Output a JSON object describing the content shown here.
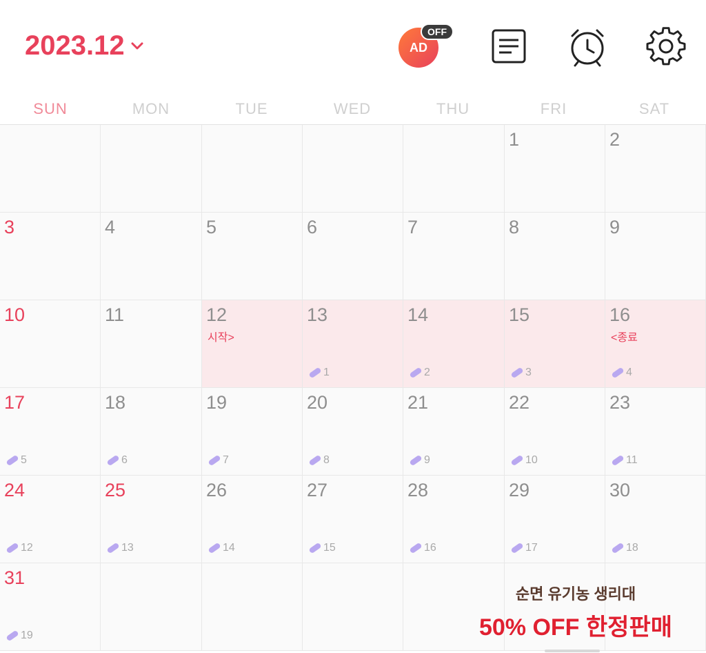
{
  "header": {
    "month": "2023.12",
    "ad_badge": "AD",
    "ad_off": "OFF"
  },
  "weekdays": [
    "SUN",
    "MON",
    "TUE",
    "WED",
    "THU",
    "FRI",
    "SAT"
  ],
  "weeks": [
    [
      {
        "d": ""
      },
      {
        "d": ""
      },
      {
        "d": ""
      },
      {
        "d": ""
      },
      {
        "d": ""
      },
      {
        "d": "1"
      },
      {
        "d": "2"
      }
    ],
    [
      {
        "d": "3",
        "red": true
      },
      {
        "d": "4"
      },
      {
        "d": "5"
      },
      {
        "d": "6"
      },
      {
        "d": "7"
      },
      {
        "d": "8"
      },
      {
        "d": "9"
      }
    ],
    [
      {
        "d": "10",
        "red": true
      },
      {
        "d": "11"
      },
      {
        "d": "12",
        "hl": true,
        "note": "시작>"
      },
      {
        "d": "13",
        "hl": true,
        "pill": "1"
      },
      {
        "d": "14",
        "hl": true,
        "pill": "2"
      },
      {
        "d": "15",
        "hl": true,
        "pill": "3"
      },
      {
        "d": "16",
        "hl": true,
        "note": "<종료",
        "pill": "4"
      }
    ],
    [
      {
        "d": "17",
        "red": true,
        "pill": "5"
      },
      {
        "d": "18",
        "pill": "6"
      },
      {
        "d": "19",
        "pill": "7"
      },
      {
        "d": "20",
        "pill": "8"
      },
      {
        "d": "21",
        "pill": "9"
      },
      {
        "d": "22",
        "pill": "10"
      },
      {
        "d": "23",
        "pill": "11"
      }
    ],
    [
      {
        "d": "24",
        "red": true,
        "pill": "12"
      },
      {
        "d": "25",
        "red": true,
        "pill": "13"
      },
      {
        "d": "26",
        "pill": "14"
      },
      {
        "d": "27",
        "pill": "15"
      },
      {
        "d": "28",
        "pill": "16"
      },
      {
        "d": "29",
        "pill": "17"
      },
      {
        "d": "30",
        "pill": "18"
      }
    ],
    [
      {
        "d": "31",
        "red": true,
        "pill": "19"
      },
      {
        "d": ""
      },
      {
        "d": ""
      },
      {
        "d": ""
      },
      {
        "d": ""
      },
      {
        "d": ""
      },
      {
        "d": ""
      }
    ]
  ],
  "ad": {
    "line1": "순면 유기농 생리대",
    "line2": "50% OFF 한정판매"
  },
  "colors": {
    "accent": "#e8415b",
    "highlight": "#fbe9eb",
    "pill": "#b9a8f0"
  },
  "icons": [
    "chevron-down-icon",
    "ad-off-icon",
    "notes-icon",
    "alarm-icon",
    "gear-icon",
    "pill-icon"
  ]
}
